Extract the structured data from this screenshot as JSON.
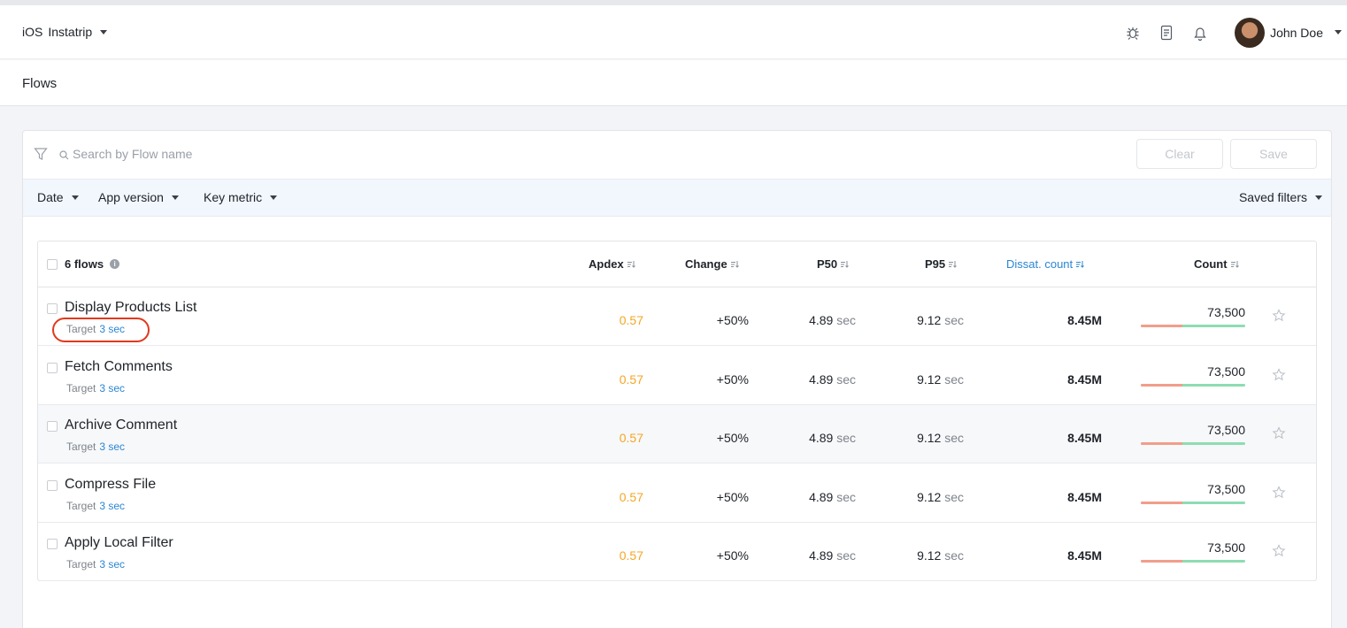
{
  "app": {
    "platform": "iOS",
    "name": "Instatrip"
  },
  "user": {
    "name": "John Doe"
  },
  "icons": [
    "bug-icon",
    "document-icon",
    "bell-icon"
  ],
  "page": {
    "title": "Flows"
  },
  "search": {
    "placeholder": "Search by Flow name",
    "clear_label": "Clear",
    "save_label": "Save"
  },
  "filters": {
    "date": "Date",
    "app_version": "App version",
    "key_metric": "Key metric",
    "saved_filters": "Saved filters"
  },
  "table": {
    "flows_count": "6 flows",
    "columns": {
      "apdex": "Apdex",
      "change": "Change",
      "p50": "P50",
      "p95": "P95",
      "dissat": "Dissat. count",
      "count": "Count"
    },
    "rows": [
      {
        "name": "Display Products List",
        "target_label": "Target",
        "target": "3 sec",
        "apdex": "0.57",
        "change": "+50%",
        "p50": "4.89",
        "p95": "9.12",
        "unit": "sec",
        "dissat": "8.45M",
        "count": "73,500",
        "bad_fraction": 0.4
      },
      {
        "name": "Fetch Comments",
        "target_label": "Target",
        "target": "3 sec",
        "apdex": "0.57",
        "change": "+50%",
        "p50": "4.89",
        "p95": "9.12",
        "unit": "sec",
        "dissat": "8.45M",
        "count": "73,500",
        "bad_fraction": 0.4
      },
      {
        "name": "Archive Comment",
        "target_label": "Target",
        "target": "3 sec",
        "apdex": "0.57",
        "change": "+50%",
        "p50": "4.89",
        "p95": "9.12",
        "unit": "sec",
        "dissat": "8.45M",
        "count": "73,500",
        "bad_fraction": 0.4
      },
      {
        "name": "Compress File",
        "target_label": "Target",
        "target": "3 sec",
        "apdex": "0.57",
        "change": "+50%",
        "p50": "4.89",
        "p95": "9.12",
        "unit": "sec",
        "dissat": "8.45M",
        "count": "73,500",
        "bad_fraction": 0.4
      },
      {
        "name": "Apply Local Filter",
        "target_label": "Target",
        "target": "3 sec",
        "apdex": "0.57",
        "change": "+50%",
        "p50": "4.89",
        "p95": "9.12",
        "unit": "sec",
        "dissat": "8.45M",
        "count": "73,500",
        "bad_fraction": 0.4
      }
    ]
  },
  "colors": {
    "apdex": "#f5a623",
    "link": "#2a86d3",
    "bar_bad": "#f19e8a",
    "bar_good": "#8edcb2",
    "highlight": "#e3381c"
  }
}
